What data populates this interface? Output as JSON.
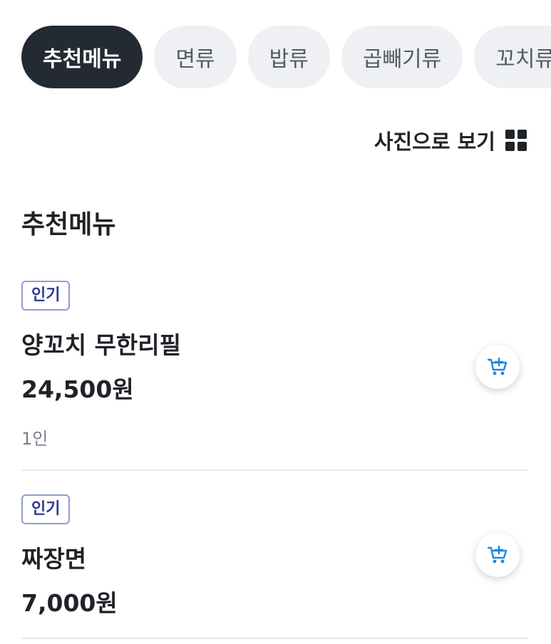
{
  "categories": [
    {
      "label": "추천메뉴",
      "active": true
    },
    {
      "label": "면류",
      "active": false
    },
    {
      "label": "밥류",
      "active": false
    },
    {
      "label": "곱빼기류",
      "active": false
    },
    {
      "label": "꼬치류",
      "active": false
    }
  ],
  "view_toggle": {
    "label": "사진으로 보기",
    "icon": "grid-icon"
  },
  "section": {
    "title": "추천메뉴"
  },
  "menu_items": [
    {
      "badge": "인기",
      "name": "양꼬치 무한리필",
      "price": "24,500원",
      "desc": "1인",
      "cart_icon": "cart-add-icon"
    },
    {
      "badge": "인기",
      "name": "짜장면",
      "price": "7,000원",
      "cart_icon": "cart-add-icon"
    }
  ],
  "colors": {
    "accent_dark": "#232a31",
    "badge_border": "#8e9cd8",
    "cart_icon": "#1e88e5"
  }
}
